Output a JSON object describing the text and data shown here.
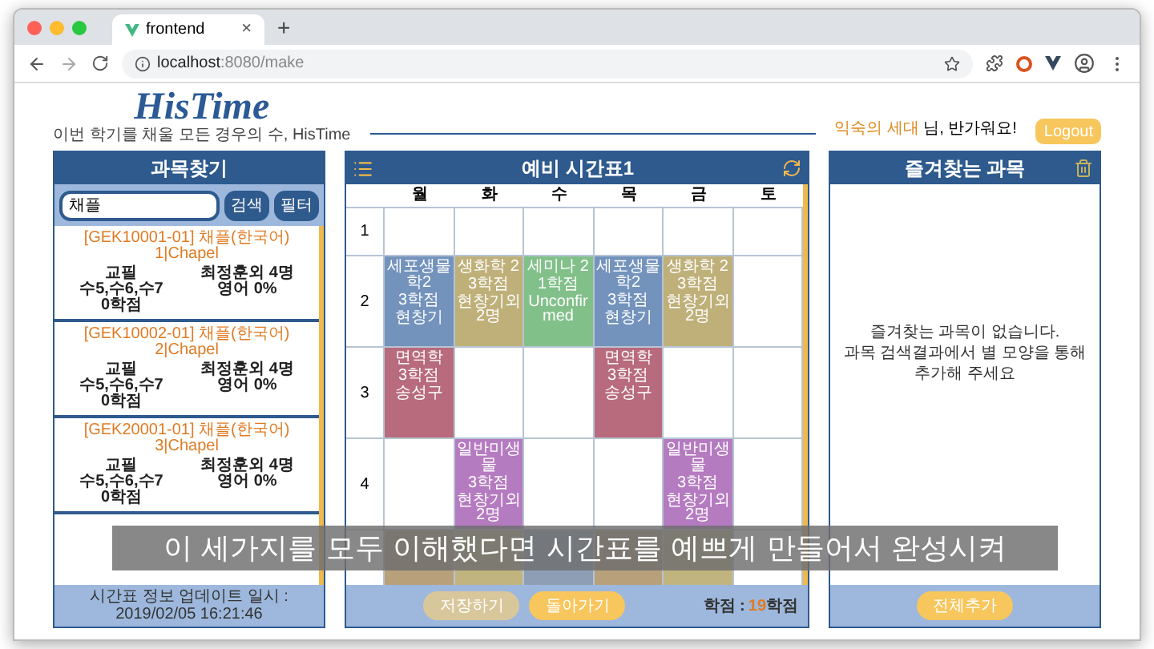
{
  "browser": {
    "tab_title": "frontend",
    "tab_close": "×",
    "new_tab": "+",
    "url_host": "localhost",
    "url_path": ":8080/make"
  },
  "header": {
    "logo": "HisTime",
    "tagline": "이번 학기를 채울 모든 경우의 수, HisTime",
    "user_name": "익숙의 세대",
    "greeting": "님, 반가워요!",
    "logout": "Logout"
  },
  "search_panel": {
    "title": "과목찾기",
    "search": {
      "value": "채플"
    },
    "search_button": "검색",
    "filter_button": "필터",
    "results": [
      {
        "title": "[GEK10001-01] 채플(한국어) 1|Chapel",
        "type": "교필",
        "times": "수5,수6,수7",
        "credits": "0학점",
        "instructor": "최정훈외 4명",
        "english": "영어 0%"
      },
      {
        "title": "[GEK10002-01] 채플(한국어) 2|Chapel",
        "type": "교필",
        "times": "수5,수6,수7",
        "credits": "0학점",
        "instructor": "최정훈외 4명",
        "english": "영어 0%"
      },
      {
        "title": "[GEK20001-01] 채플(한국어) 3|Chapel",
        "type": "교필",
        "times": "수5,수6,수7",
        "credits": "0학점",
        "instructor": "최정훈외 4명",
        "english": "영어 0%"
      }
    ],
    "updated": "시간표 정보 업데이트 일시 : 2019/02/05 16:21:46"
  },
  "timetable": {
    "title": "예비 시간표1",
    "days": [
      "월",
      "화",
      "수",
      "목",
      "금",
      "토"
    ],
    "rows": [
      {
        "label": "1",
        "cells": [
          null,
          null,
          null,
          null,
          null,
          null
        ]
      },
      {
        "label": "2",
        "cells": [
          {
            "name": "세포생물학2",
            "credits": "3학점",
            "instructor": "현창기",
            "color": "#7393bd"
          },
          {
            "name": "생화학 2",
            "credits": "3학점",
            "instructor": "현창기외 2명",
            "color": "#bfb07a"
          },
          {
            "name": "세미나 2",
            "credits": "1학점",
            "instructor": "Unconfirmed",
            "color": "#82c08a"
          },
          {
            "name": "세포생물학2",
            "credits": "3학점",
            "instructor": "현창기",
            "color": "#7393bd"
          },
          {
            "name": "생화학 2",
            "credits": "3학점",
            "instructor": "현창기외 2명",
            "color": "#bfb07a"
          },
          null
        ]
      },
      {
        "label": "3",
        "cells": [
          {
            "name": "면역학",
            "credits": "3학점",
            "instructor": "송성구",
            "color": "#b86b7d"
          },
          null,
          null,
          {
            "name": "면역학",
            "credits": "3학점",
            "instructor": "송성구",
            "color": "#b86b7d"
          },
          null,
          null
        ]
      },
      {
        "label": "4",
        "cells": [
          null,
          {
            "name": "일반미생물",
            "credits": "3학점",
            "instructor": "현창기외 2명",
            "color": "#b57bc0"
          },
          null,
          null,
          {
            "name": "일반미생물",
            "credits": "3학점",
            "instructor": "현창기외 2명",
            "color": "#b57bc0"
          },
          null
        ]
      },
      {
        "cells": [
          {
            "color": "#b8a07a"
          },
          {
            "color": "#c2b47f"
          },
          {
            "color": "#8e9fb5"
          },
          {
            "color": "#b8a07a"
          },
          {
            "color": "#c2b47f"
          },
          null
        ]
      }
    ],
    "save_button": {
      "label": "저장하기",
      "disabled": true
    },
    "back_button": "돌아가기",
    "credits_label": "학점 :",
    "credits_value": "19",
    "credits_unit": "학점"
  },
  "favorites_panel": {
    "title": "즐겨찾는 과목",
    "empty_line1": "즐겨찾는 과목이 없습니다.",
    "empty_line2": "과목 검색결과에서 별 모양을 통해 추가해 주세요",
    "add_all": "전체추가"
  },
  "caption": "이 세가지를 모두 이해했다면 시간표를 예쁘게 만들어서 완성시켜"
}
